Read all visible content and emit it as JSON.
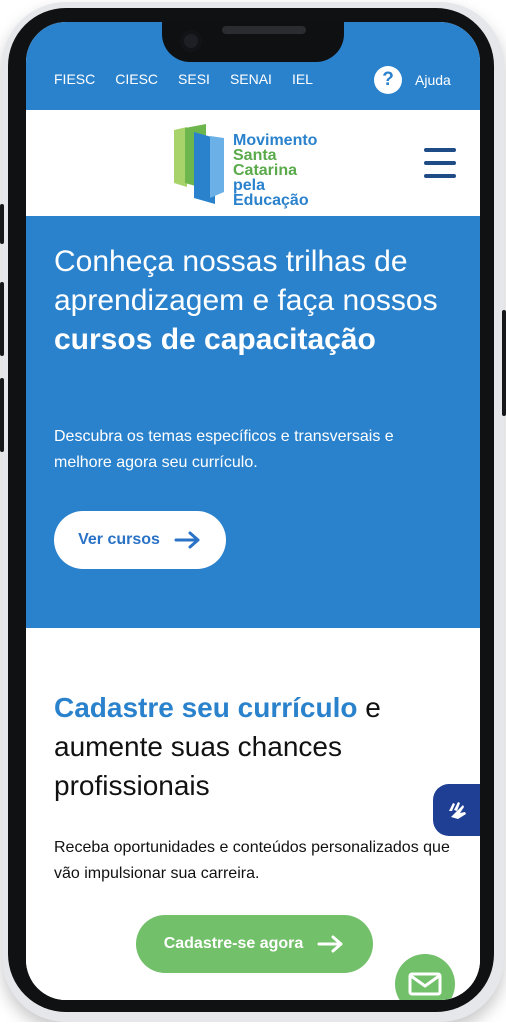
{
  "topbar": {
    "links": [
      "FIESC",
      "CIESC",
      "SESI",
      "SENAI",
      "IEL"
    ],
    "help_label": "Ajuda",
    "help_icon": "?"
  },
  "brand": {
    "lines": [
      "Movimento",
      "Santa Catarina",
      "pela Educação"
    ],
    "colors": {
      "primary_blue": "#2a82cd",
      "dark_blue": "#1f4b86",
      "green": "#5aaa4b",
      "button_green": "#73c06b"
    }
  },
  "hero": {
    "title_prefix": "Conheça nossas trilhas de aprendizagem e faça nossos ",
    "title_bold": "cursos de capacitação",
    "subtitle": "Descubra os temas específicos e transversais e melhore agora seu currículo.",
    "button_label": "Ver cursos"
  },
  "cv_section": {
    "title_highlight": "Cadastre seu currículo",
    "title_rest": " e aumente suas chances profissionais",
    "subtitle": "Receba oportunidades e conteúdos personalizados que vão impulsionar sua carreira.",
    "button_label": "Cadastre-se agora"
  },
  "icons": {
    "menu": "menu-icon",
    "arrow": "arrow-right-icon",
    "accessibility": "hand-sign-icon",
    "mail": "mail-icon"
  }
}
